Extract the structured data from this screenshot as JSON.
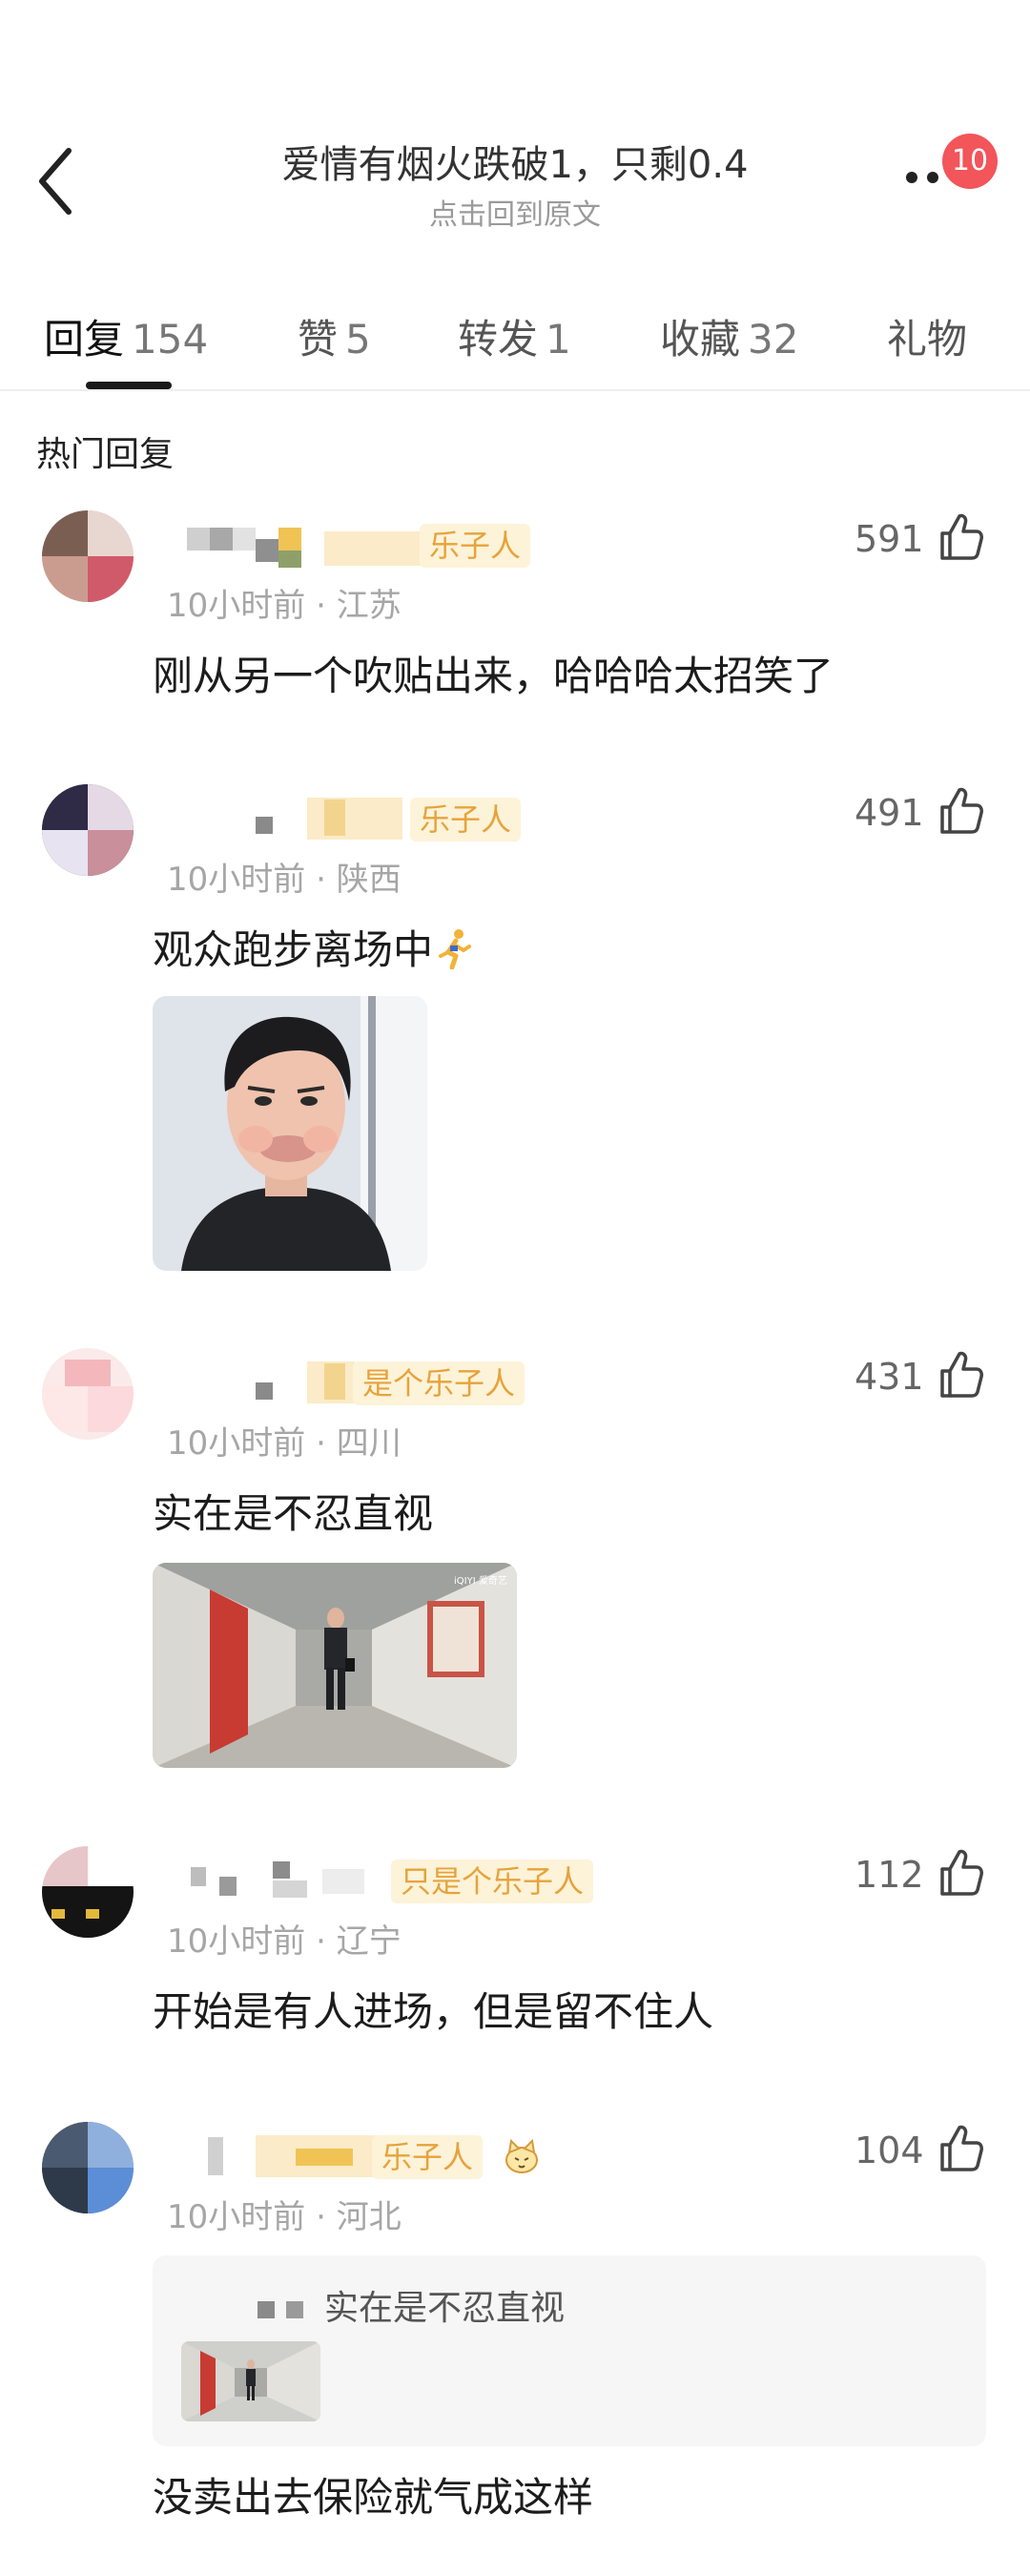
{
  "header": {
    "title": "爱情有烟火跌破1，只剩0.4",
    "subtitle": "点击回到原文",
    "notification_count": "10"
  },
  "tabs": [
    {
      "label": "回复",
      "count": "154",
      "active": true
    },
    {
      "label": "赞",
      "count": "5"
    },
    {
      "label": "转发",
      "count": "1"
    },
    {
      "label": "收藏",
      "count": "32"
    },
    {
      "label": "礼物",
      "count": ""
    }
  ],
  "section_title": "热门回复",
  "comments": [
    {
      "user_tag": "乐子人",
      "time": "10小时前",
      "location": "江苏",
      "likes": "591",
      "text": "刚从另一个吹贴出来，哈哈哈太招笑了"
    },
    {
      "user_tag": "乐子人",
      "time": "10小时前",
      "location": "陕西",
      "likes": "491",
      "text": "观众跑步离场中",
      "emoji": "running-person-icon"
    },
    {
      "user_tag": "是个乐子人",
      "time": "10小时前",
      "location": "四川",
      "likes": "431",
      "text": "实在是不忍直视",
      "image_watermark": "iQIYI 爱奇艺"
    },
    {
      "user_tag": "只是个乐子人",
      "time": "10小时前",
      "location": "辽宁",
      "likes": "112",
      "text": "开始是有人进场，但是留不住人"
    },
    {
      "user_tag": "乐子人",
      "time": "10小时前",
      "location": "河北",
      "likes": "104",
      "quote_text": "实在是不忍直视",
      "text": "没卖出去保险就气成这样"
    }
  ],
  "colors": {
    "badge": "#f2555a",
    "tag_bg": "#fdf3d9",
    "tag_text": "#e6a33c",
    "meta": "#a6a6a6"
  }
}
